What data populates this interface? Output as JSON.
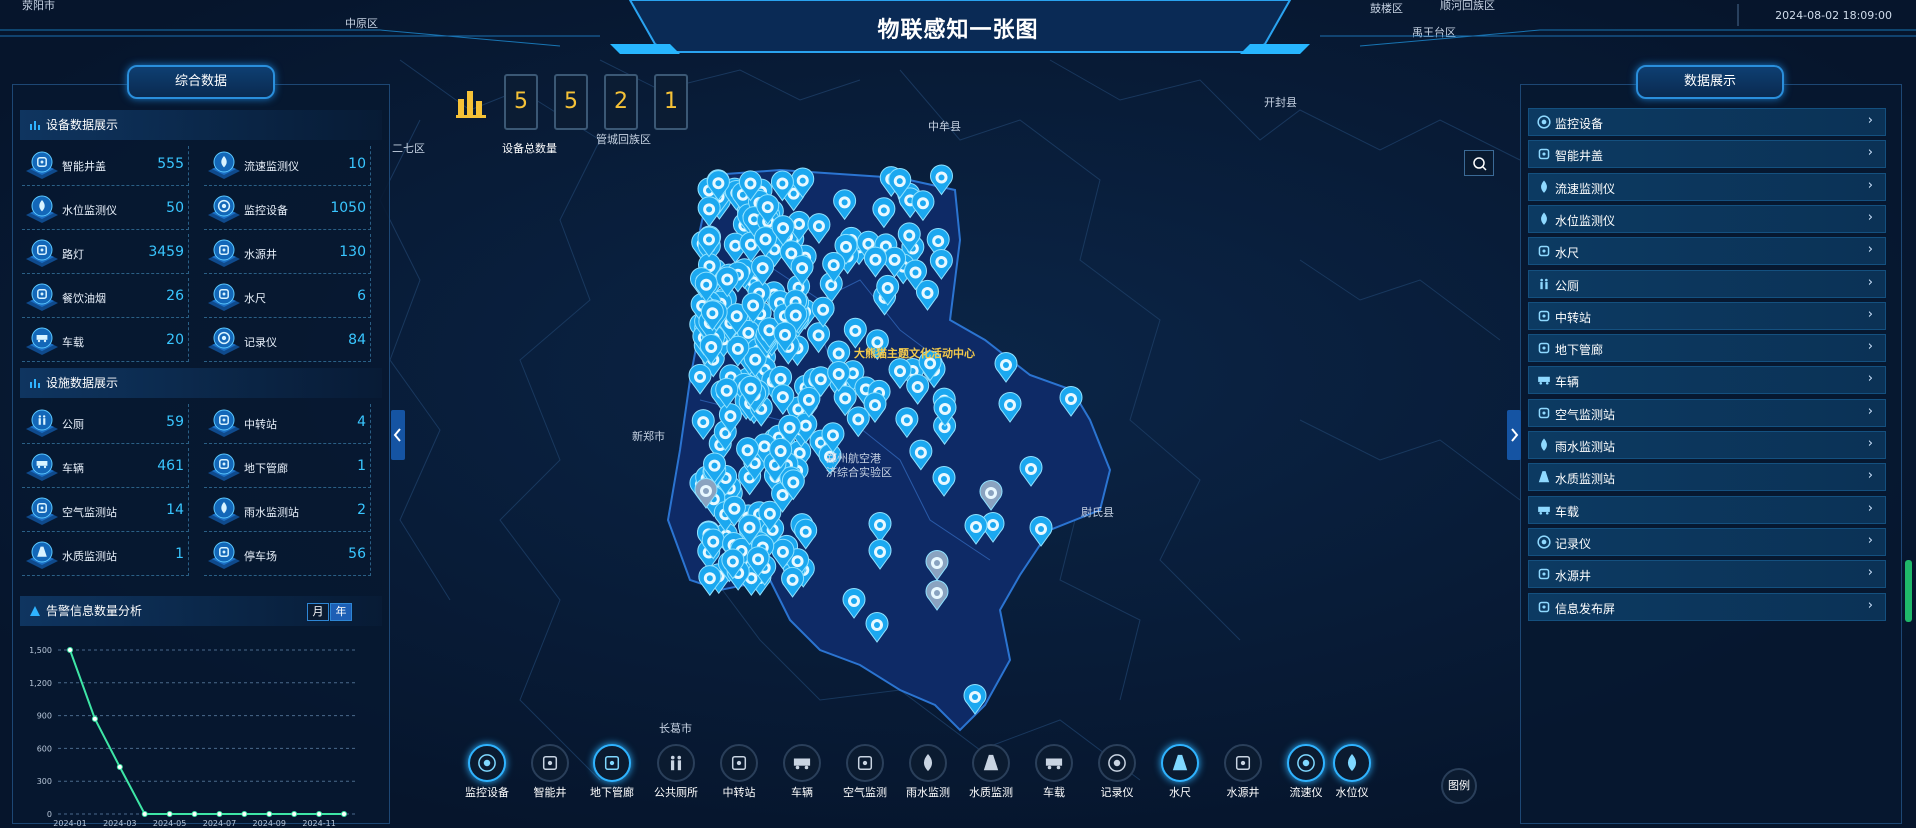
{
  "header": {
    "title": "物联感知一张图",
    "datetime": "2024-08-02 18:09:00"
  },
  "map_labels": {
    "zhongyuan": "中原区",
    "erqi": "二七区",
    "guancheng": "管城回族区",
    "zhongmou": "中牟县",
    "kaifeng": "开封县",
    "xinzheng": "新郑市",
    "zhengzhou_airport_1": "郑州航空港",
    "zhengzhou_airport_2": "济综合实验区",
    "weishi": "尉氏县",
    "changge": "长葛市",
    "gulou": "鼓楼区",
    "shuihe": "顺河回族区",
    "yuwangtai": "禹王台区",
    "xingyang": "荥阳市",
    "poi": "大熊猫主题文化活动中心"
  },
  "left_panel": {
    "tab": "综合数据",
    "device_section_title": "设备数据展示",
    "devices": [
      {
        "name": "智能井盖",
        "value": "555",
        "icon": "manhole-icon"
      },
      {
        "name": "流速监测仪",
        "value": "10",
        "icon": "flow-meter-icon"
      },
      {
        "name": "水位监测仪",
        "value": "50",
        "icon": "water-level-icon"
      },
      {
        "name": "监控设备",
        "value": "1050",
        "icon": "camera-icon"
      },
      {
        "name": "路灯",
        "value": "3459",
        "icon": "streetlight-icon"
      },
      {
        "name": "水源井",
        "value": "130",
        "icon": "well-icon"
      },
      {
        "name": "餐饮油烟",
        "value": "26",
        "icon": "smoke-icon"
      },
      {
        "name": "水尺",
        "value": "6",
        "icon": "gauge-icon"
      },
      {
        "name": "车载",
        "value": "20",
        "icon": "vehicle-icon"
      },
      {
        "name": "记录仪",
        "value": "84",
        "icon": "recorder-icon"
      }
    ],
    "facility_section_title": "设施数据展示",
    "facilities": [
      {
        "name": "公厕",
        "value": "59",
        "icon": "toilet-icon"
      },
      {
        "name": "中转站",
        "value": "4",
        "icon": "transfer-station-icon"
      },
      {
        "name": "车辆",
        "value": "461",
        "icon": "truck-icon"
      },
      {
        "name": "地下管廊",
        "value": "1",
        "icon": "pipe-icon"
      },
      {
        "name": "空气监测站",
        "value": "14",
        "icon": "air-icon"
      },
      {
        "name": "雨水监测站",
        "value": "2",
        "icon": "rain-icon"
      },
      {
        "name": "水质监测站",
        "value": "1",
        "icon": "flask-icon"
      },
      {
        "name": "停车场",
        "value": "56",
        "icon": "parking-icon"
      }
    ],
    "alarm_section_title": "告警信息数量分析",
    "toggle": {
      "month": "月",
      "year": "年"
    }
  },
  "chart_data": {
    "type": "line",
    "title": "",
    "x": [
      "2024-01",
      "2024-02",
      "2024-03",
      "2024-04",
      "2024-05",
      "2024-06",
      "2024-07",
      "2024-08",
      "2024-09",
      "2024-10",
      "2024-11",
      "2024-12"
    ],
    "x_tick_labels": [
      "2024-01",
      "2024-03",
      "2024-05",
      "2024-07",
      "2024-09",
      "2024-11"
    ],
    "values": [
      1500,
      870,
      430,
      0,
      0,
      0,
      0,
      0,
      0,
      0,
      0,
      0
    ],
    "yticks": [
      "1,500",
      "1,200",
      "900",
      "600",
      "300",
      "0"
    ],
    "ylim": [
      0,
      1500
    ],
    "color": "#3ee6a6",
    "grid": true
  },
  "counter": {
    "digits": [
      "5",
      "5",
      "2",
      "1"
    ],
    "label": "设备总数量"
  },
  "right_panel": {
    "tab": "数据展示",
    "items": [
      {
        "label": "监控设备",
        "icon": "camera-icon"
      },
      {
        "label": "智能井盖",
        "icon": "manhole-icon"
      },
      {
        "label": "流速监测仪",
        "icon": "flow-meter-icon"
      },
      {
        "label": "水位监测仪",
        "icon": "water-level-icon"
      },
      {
        "label": "水尺",
        "icon": "gauge-icon"
      },
      {
        "label": "公厕",
        "icon": "toilet-icon"
      },
      {
        "label": "中转站",
        "icon": "transfer-station-icon"
      },
      {
        "label": "地下管廊",
        "icon": "pipe-icon"
      },
      {
        "label": "车辆",
        "icon": "truck-icon"
      },
      {
        "label": "空气监测站",
        "icon": "air-icon"
      },
      {
        "label": "雨水监测站",
        "icon": "rain-icon"
      },
      {
        "label": "水质监测站",
        "icon": "flask-icon"
      },
      {
        "label": "车载",
        "icon": "vehicle-icon"
      },
      {
        "label": "记录仪",
        "icon": "recorder-icon"
      },
      {
        "label": "水源井",
        "icon": "well-icon"
      },
      {
        "label": "信息发布屏",
        "icon": "screen-icon"
      }
    ],
    "chevron": "›"
  },
  "toolbar": {
    "items": [
      {
        "label": "监控设备",
        "active": true
      },
      {
        "label": "智能井",
        "active": false
      },
      {
        "label": "地下管廊",
        "active": true
      },
      {
        "label": "公共厕所",
        "active": false
      },
      {
        "label": "中转站",
        "active": false
      },
      {
        "label": "车辆",
        "active": false
      },
      {
        "label": "空气监测",
        "active": false
      },
      {
        "label": "雨水监测",
        "active": false
      },
      {
        "label": "水质监测",
        "active": false
      },
      {
        "label": "车载",
        "active": false
      },
      {
        "label": "记录仪",
        "active": false
      },
      {
        "label": "水尺",
        "active": true
      },
      {
        "label": "水源井",
        "active": false
      },
      {
        "label": "流速仪",
        "active": true
      },
      {
        "label": "水位仪",
        "active": true
      }
    ],
    "legend_label": "图例"
  },
  "colors": {
    "accent": "#2fb3ff",
    "value": "#39c6ff",
    "digit": "#f6c237",
    "marker": "#1ba8f0",
    "region": "#0e2a66"
  }
}
